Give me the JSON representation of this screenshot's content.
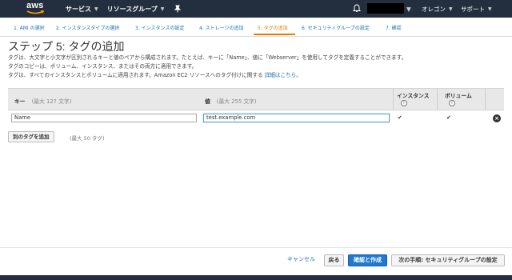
{
  "nav": {
    "logo": "aws",
    "services": "サービス",
    "resource_groups": "リソースグループ",
    "region": "オレゴン",
    "support": "サポート"
  },
  "steps": [
    {
      "label": "1. AMI の選択"
    },
    {
      "label": "2. インスタンスタイプの選択"
    },
    {
      "label": "3. インスタンスの設定"
    },
    {
      "label": "4. ストレージの追加"
    },
    {
      "label": "5. タグの追加",
      "active": true
    },
    {
      "label": "6. セキュリティグループの設定"
    },
    {
      "label": "7. 確認"
    }
  ],
  "page": {
    "title": "ステップ 5: タグの追加",
    "desc1": "タグは、大文字と小文字が区別されるキーと値のペアから構成されます。たとえば、キーに「Name」、値に「Webserver」を使用してタグを定義することができます。",
    "desc2": "タグのコピーは、ボリューム、インスタンス、またはその両方に適用できます。",
    "desc3": "タグは、すべてのインスタンスとボリュームに適用されます。Amazon EC2 リソースへのタグ付けに関する",
    "desc_link": "詳細はこちら。"
  },
  "table": {
    "key_header": "キー",
    "key_hint": "(最大 127 文字)",
    "value_header": "値",
    "value_hint": "(最大 255 文字)",
    "instances_header": "インスタンス",
    "volumes_header": "ボリューム",
    "rows": [
      {
        "key": "Name",
        "value": "test.example.com",
        "instances": true,
        "volumes": true
      }
    ]
  },
  "add_tag": {
    "button": "別のタグを追加",
    "note": "(最大 50 タグ)"
  },
  "actions": {
    "cancel": "キャンセル",
    "back": "戻る",
    "review": "確認と作成",
    "next": "次の手順: セキュリティグループの設定"
  },
  "colors": {
    "nav_bg": "#232f3e",
    "active_step": "#e07b00",
    "link": "#1a6fb3",
    "primary": "#1f7ad0"
  }
}
